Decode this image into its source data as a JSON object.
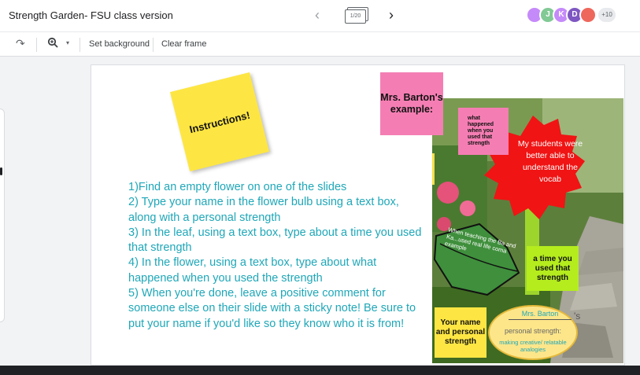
{
  "header": {
    "title": "Strength Garden- FSU class version",
    "frame_counter": "1/20",
    "avatars": [
      {
        "label": "",
        "color": "#c58af9"
      },
      {
        "label": "J",
        "color": "#81c995"
      },
      {
        "label": "K",
        "color": "#c58af9"
      },
      {
        "label": "D",
        "color": "#7e57c2"
      },
      {
        "label": "",
        "color": "#ee675c"
      }
    ],
    "more_count": "+10"
  },
  "toolbar": {
    "set_background": "Set background",
    "clear_frame": "Clear frame"
  },
  "slide": {
    "instructions_note": "Instructions!",
    "instructions": [
      "1)Find an empty flower on one of the slides",
      "2) Type your name in the flower bulb using a text box, along with a personal strength",
      "3) In the leaf, using a text box, type about a time you used that strength",
      "4) In the flower, using a text box, type about what happened when you used the strength",
      "5) When you're done, leave a positive comment for someone else on their slide with a sticky note! Be sure to put your name if you'd like so they know who it is from!"
    ],
    "example_note": "Mrs. Barton's example:",
    "what_happened_note": "what happened when you used that strength",
    "flower_text": "My students were better able to understand the vocab",
    "leaf_text": "When teaching the Ba and Ka...used real life coma example",
    "time_used_note": "a time you used that strength",
    "your_name_note": "Your name and personal strength",
    "bulb_name": "Mrs. Barton",
    "bulb_possessive": "'s",
    "bulb_label": "personal strength:",
    "bulb_strength": "making creative/ relatable analogies"
  }
}
